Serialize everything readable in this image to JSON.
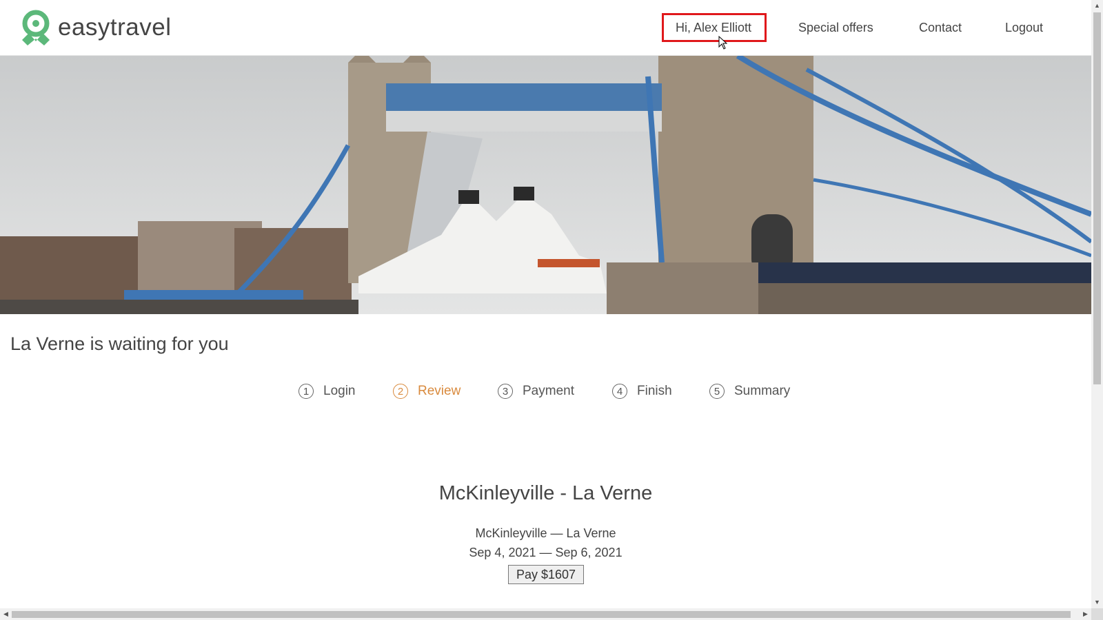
{
  "brand": {
    "name": "easytravel",
    "color": "#5cb87a"
  },
  "nav": {
    "greeting": "Hi, Alex Elliott",
    "special_offers": "Special offers",
    "contact": "Contact",
    "logout": "Logout",
    "highlight_color": "#e0181b"
  },
  "hero": {
    "image": "tower-bridge-photo"
  },
  "headline": "La Verne is waiting for you",
  "steps": [
    {
      "num": "1",
      "label": "Login"
    },
    {
      "num": "2",
      "label": "Review"
    },
    {
      "num": "3",
      "label": "Payment"
    },
    {
      "num": "4",
      "label": "Finish"
    },
    {
      "num": "5",
      "label": "Summary"
    }
  ],
  "active_step_color": "#d98a3d",
  "trip": {
    "title": "McKinleyville - La Verne",
    "route": "McKinleyville — La Verne",
    "dates": "Sep 4, 2021 — Sep 6, 2021",
    "pay_label": "Pay $1607"
  }
}
